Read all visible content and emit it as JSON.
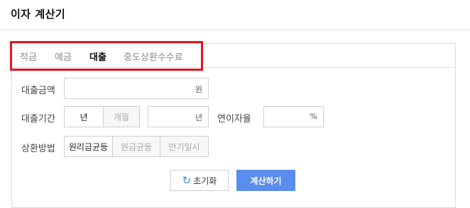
{
  "header": {
    "title": "이자 계산기"
  },
  "tabs": [
    {
      "label": "적금",
      "active": false
    },
    {
      "label": "예금",
      "active": false
    },
    {
      "label": "대출",
      "active": true
    },
    {
      "label": "중도상환수수료",
      "active": false
    }
  ],
  "form": {
    "loan_amount": {
      "label": "대출금액",
      "value": "",
      "unit": "원"
    },
    "loan_period": {
      "label": "대출기간",
      "options": [
        {
          "label": "년",
          "selected": true
        },
        {
          "label": "개월",
          "selected": false
        }
      ],
      "value": "",
      "unit": "년"
    },
    "interest_rate": {
      "label": "연이자율",
      "value": "",
      "unit": "%"
    },
    "repayment": {
      "label": "상환방법",
      "options": [
        {
          "label": "원리금균등",
          "selected": true
        },
        {
          "label": "원금균등",
          "selected": false
        },
        {
          "label": "만기일시",
          "selected": false
        }
      ]
    }
  },
  "buttons": {
    "reset_label": "초기화",
    "reset_icon": "refresh-icon",
    "calc_label": "계산하기"
  },
  "colors": {
    "highlight": "#e5141f",
    "primary": "#5b8def",
    "refresh_icon": "#3d8ee0"
  }
}
